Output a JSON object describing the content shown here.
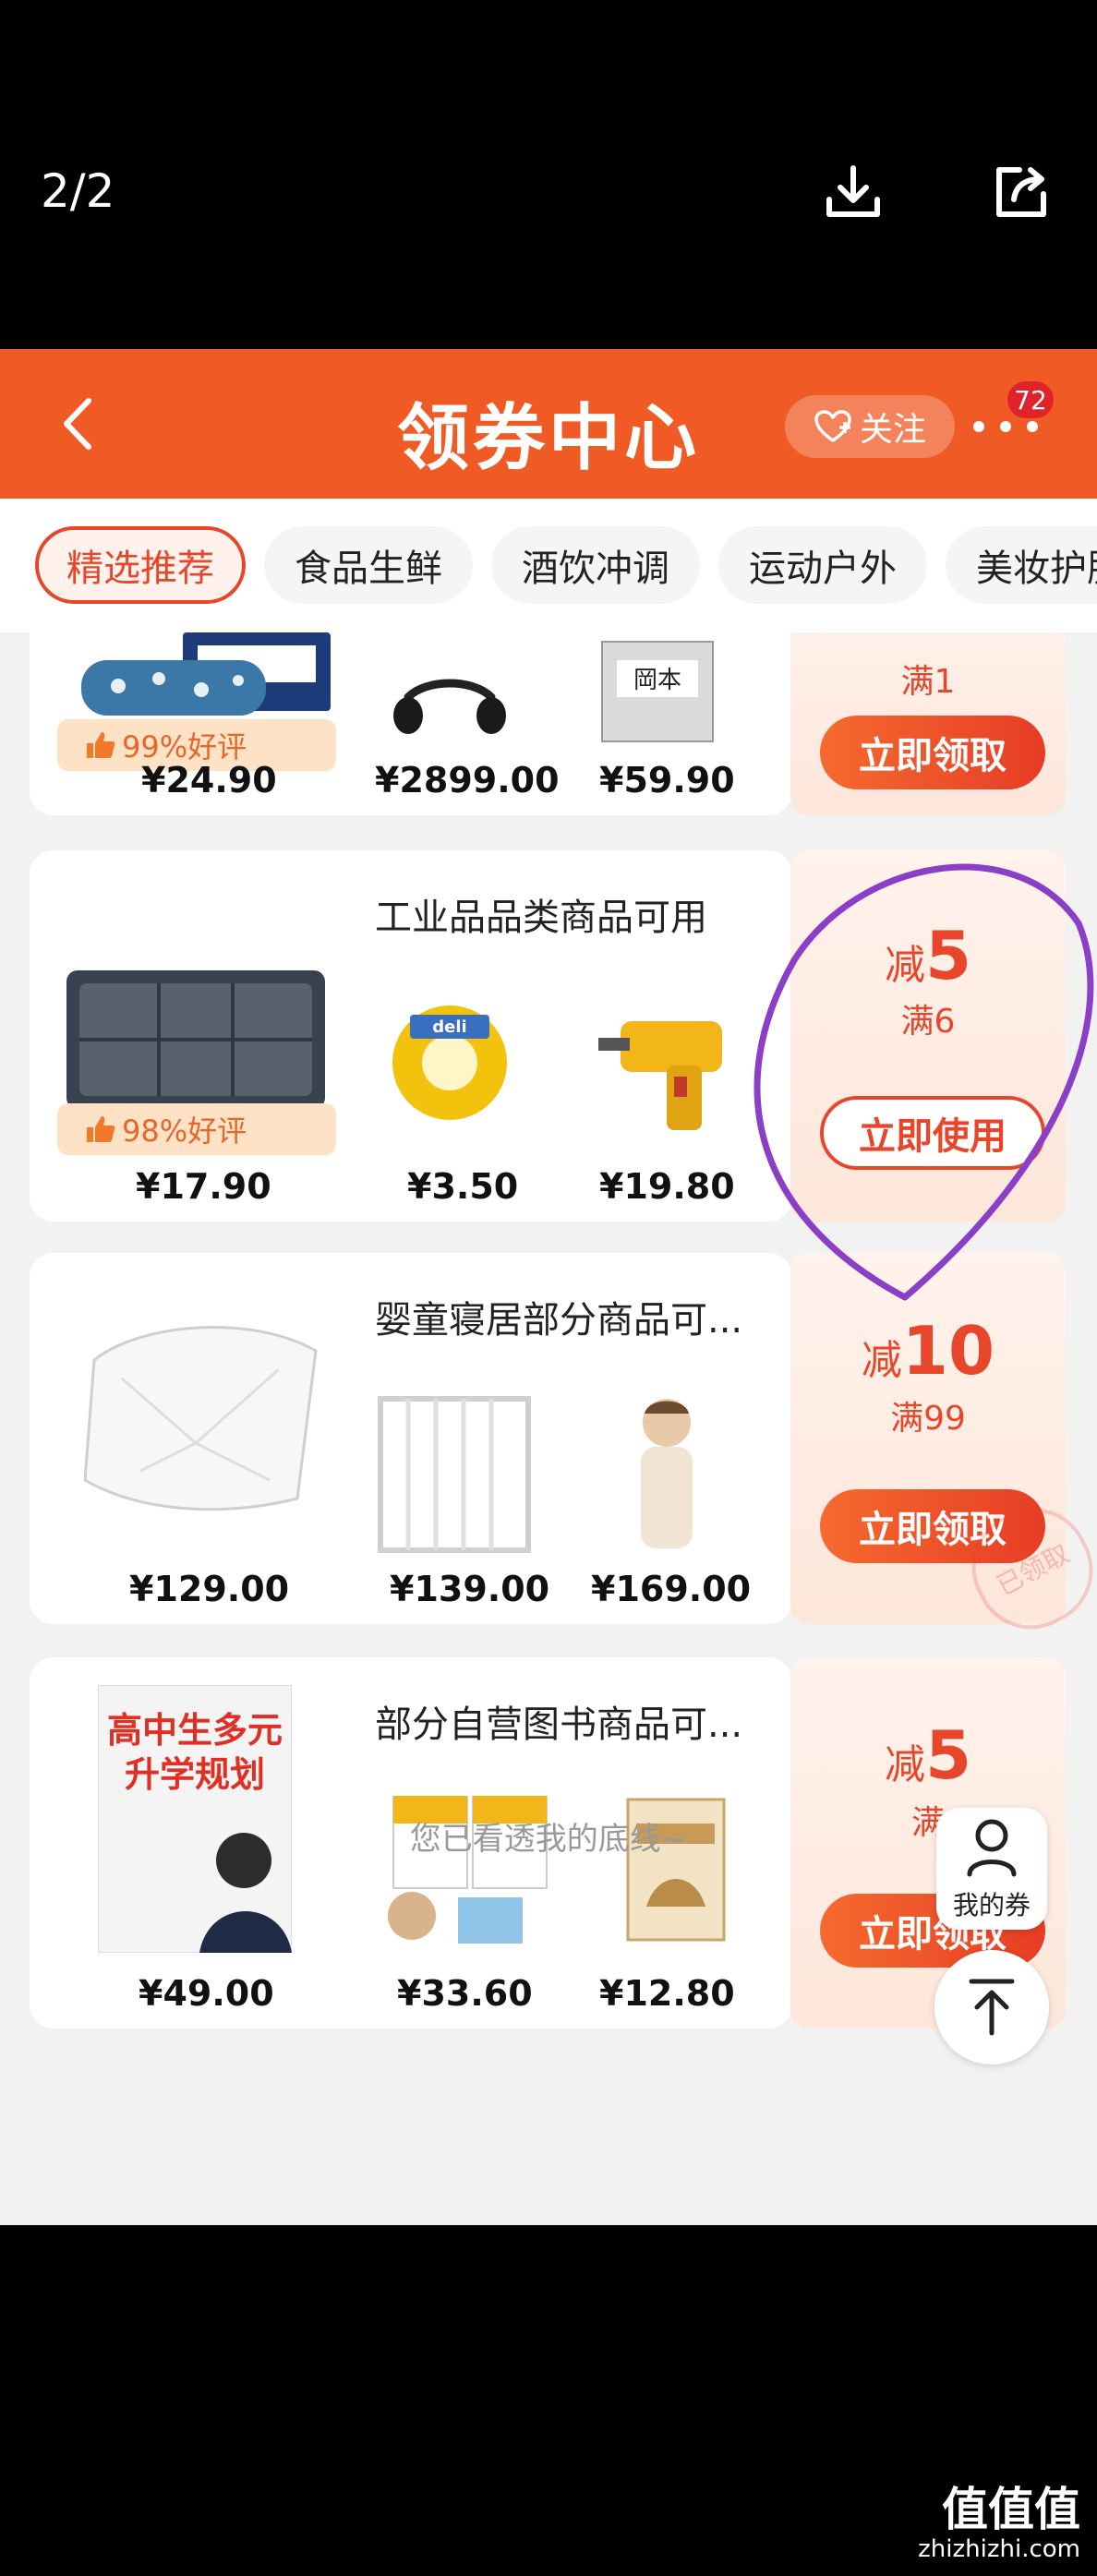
{
  "viewer": {
    "index": "2/2",
    "watermark_title": "值值值",
    "watermark_url": "zhizhizhi.com"
  },
  "header": {
    "title": "领券中心",
    "follow_label": "关注",
    "badge": "72"
  },
  "tabs": [
    {
      "label": "精选推荐",
      "active": true
    },
    {
      "label": "食品生鲜"
    },
    {
      "label": "酒饮冲调"
    },
    {
      "label": "运动户外"
    },
    {
      "label": "美妆护肤"
    }
  ],
  "cards": [
    {
      "rating": "99%好评",
      "prices": [
        "¥24.90",
        "¥2899.00",
        "¥59.90"
      ],
      "coupon": {
        "condition": "满1",
        "button": "立即领取"
      }
    },
    {
      "title": "工业品品类商品可用",
      "rating": "98%好评",
      "prices": [
        "¥17.90",
        "¥3.50",
        "¥19.80"
      ],
      "coupon": {
        "prefix": "减",
        "amount": "5",
        "condition": "满6",
        "button": "立即使用",
        "stamp": "已领取"
      }
    },
    {
      "title": "婴童寝居部分商品可...",
      "prices": [
        "¥129.00",
        "¥139.00",
        "¥169.00"
      ],
      "coupon": {
        "prefix": "减",
        "amount": "10",
        "condition": "满99",
        "button": "立即领取"
      }
    },
    {
      "title": "部分自营图书商品可...",
      "prices": [
        "¥49.00",
        "¥33.60",
        "¥12.80"
      ],
      "coupon": {
        "prefix": "减",
        "amount": "5",
        "condition": "满",
        "button": "立即领取"
      }
    }
  ],
  "book_cover_lines": [
    "高中生多元",
    "升学规划"
  ],
  "product_label_1": "岡本",
  "product_label_2": "deli",
  "footer": "您已看透我的底线~",
  "float": {
    "my_coupons": "我的券"
  },
  "colors": {
    "brand": "#f05a24",
    "accent": "#e8462a",
    "annotation": "#8b3fc6"
  }
}
